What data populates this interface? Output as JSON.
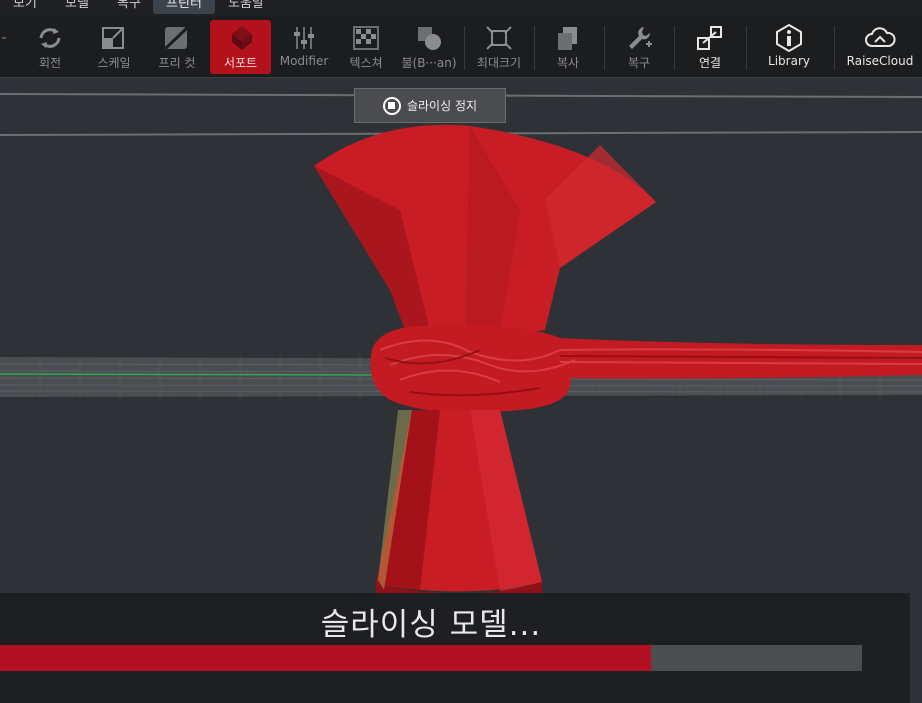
{
  "menu": [
    "보기",
    "모델",
    "복구",
    "프린터",
    "도움말"
  ],
  "menu_active": "프린터",
  "toolbar": {
    "rotate": "회전",
    "scale": "스케일",
    "free_cut": "프리 컷",
    "support": "서포트",
    "modifier": "Modifier",
    "texture": "텍스쳐",
    "boolean": "불(B···an)",
    "max_size": "최대크기",
    "copy": "복사",
    "repair": "복구",
    "connect": "연결",
    "library": "Library",
    "raisecloud": "RaiseCloud"
  },
  "stop_button": "슬라이싱 정지",
  "progress": {
    "title": "슬라이싱 모델...",
    "percent": 75.5
  },
  "colors": {
    "accent": "#b30f22",
    "model": "#c81d25"
  }
}
